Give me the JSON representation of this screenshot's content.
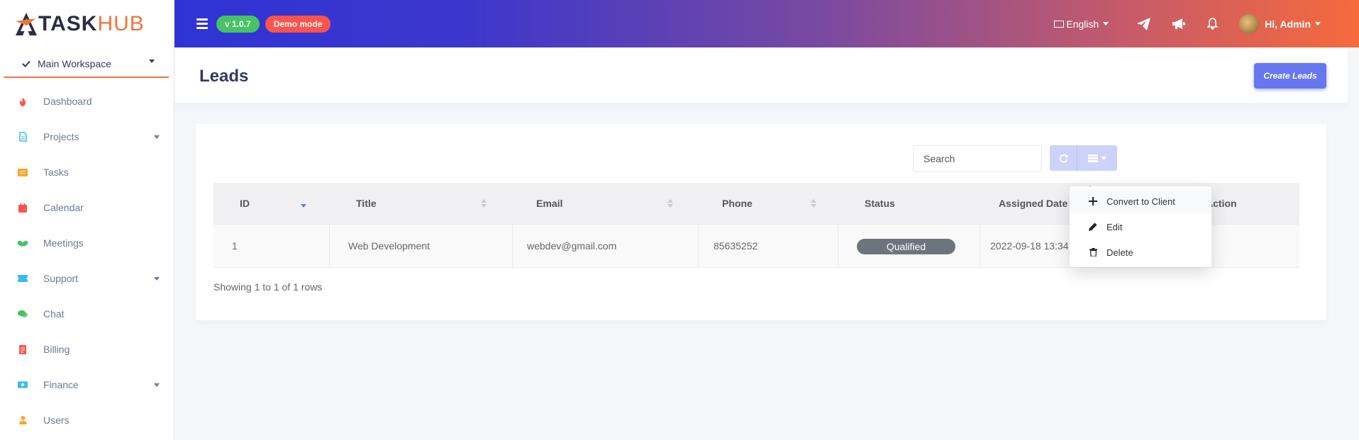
{
  "brand": {
    "part1": "TASK",
    "part2": "HUB"
  },
  "workspace": {
    "label": "Main Workspace"
  },
  "sidebar": {
    "items": [
      {
        "label": "Dashboard",
        "icon": "fire-icon",
        "color": "#fc544b",
        "has_caret": false
      },
      {
        "label": "Projects",
        "icon": "file-icon",
        "color": "#3abaf4",
        "has_caret": true
      },
      {
        "label": "Tasks",
        "icon": "list-icon",
        "color": "#ffa426",
        "has_caret": false
      },
      {
        "label": "Calendar",
        "icon": "calendar-icon",
        "color": "#fc544b",
        "has_caret": false
      },
      {
        "label": "Meetings",
        "icon": "handshake-icon",
        "color": "#47c363",
        "has_caret": false
      },
      {
        "label": "Support",
        "icon": "ticket-icon",
        "color": "#3abaf4",
        "has_caret": true
      },
      {
        "label": "Chat",
        "icon": "chat-icon",
        "color": "#47c363",
        "has_caret": false
      },
      {
        "label": "Billing",
        "icon": "receipt-icon",
        "color": "#fc544b",
        "has_caret": false
      },
      {
        "label": "Finance",
        "icon": "money-icon",
        "color": "#3abaf4",
        "has_caret": true
      },
      {
        "label": "Users",
        "icon": "user-icon",
        "color": "#ffa426",
        "has_caret": false
      }
    ]
  },
  "topbar": {
    "version": "v 1.0.7",
    "demo": "Demo mode",
    "language": "English",
    "greeting": "Hi, Admin"
  },
  "page": {
    "title": "Leads",
    "create_button": "Create Leads"
  },
  "toolbar": {
    "search_placeholder": "Search"
  },
  "table": {
    "columns": [
      "ID",
      "Title",
      "Email",
      "Phone",
      "Status",
      "Assigned Date",
      "Action"
    ],
    "rows": [
      {
        "id": "1",
        "title": "Web Development",
        "email": "webdev@gmail.com",
        "phone": "85635252",
        "status": "Qualified",
        "assigned_date": "2022-09-18 13:34"
      }
    ],
    "footer": "Showing 1 to 1 of 1 rows"
  },
  "dropdown": {
    "items": [
      {
        "label": "Convert to Client",
        "icon": "plus-icon"
      },
      {
        "label": "Edit",
        "icon": "pencil-icon"
      },
      {
        "label": "Delete",
        "icon": "trash-icon"
      }
    ]
  }
}
